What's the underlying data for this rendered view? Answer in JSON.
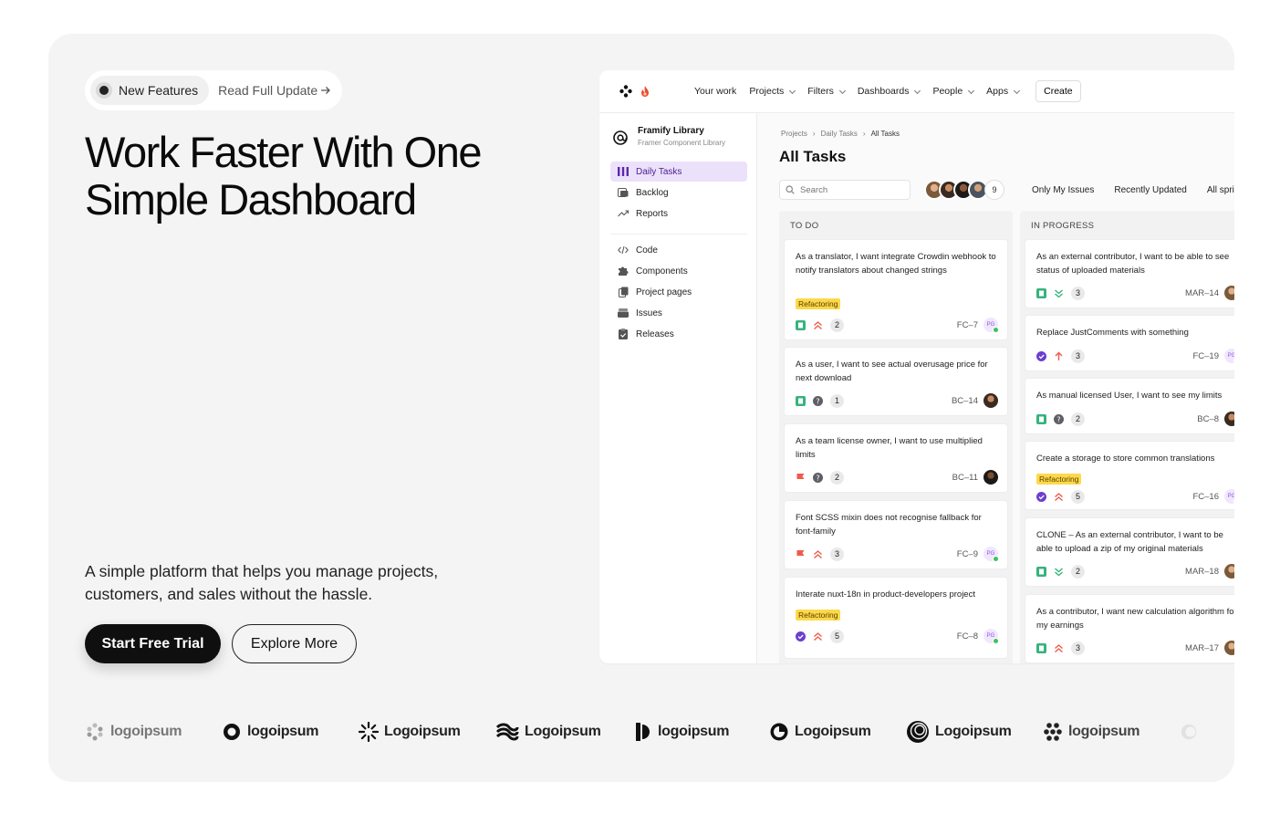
{
  "hero": {
    "badge_label": "New Features",
    "read_update_label": "Read Full Update",
    "title_line1": "Work Faster With One",
    "title_line2": "Simple Dashboard",
    "subtitle": "A simple platform that helps you manage projects, customers, and sales without the hassle.",
    "primary_cta": "Start Free Trial",
    "secondary_cta": "Explore More"
  },
  "logos": [
    "logoipsum",
    "logoipsum",
    "Logoipsum",
    "Logoipsum",
    "logoipsum",
    "Logoipsum",
    "Logoipsum",
    "logoipsum"
  ],
  "app": {
    "nav": {
      "your_work": "Your work",
      "projects": "Projects",
      "filters": "Filters",
      "dashboards": "Dashboards",
      "people": "People",
      "apps": "Apps",
      "create": "Create"
    },
    "sidebar": {
      "project_name": "Framify Library",
      "project_sub": "Framer Component Library",
      "items": [
        "Daily Tasks",
        "Backlog",
        "Reports",
        "Code",
        "Components",
        "Project pages",
        "Issues",
        "Releases"
      ]
    },
    "breadcrumb": [
      "Projects",
      "Daily Tasks",
      "All Tasks"
    ],
    "page_title": "All Tasks",
    "search_placeholder": "Search",
    "member_count": "9",
    "filters": [
      "Only My Issues",
      "Recently Updated",
      "All sprints"
    ],
    "columns": [
      {
        "title": "TO DO",
        "cards": [
          {
            "text": "As a translator, I want integrate Crowdin webhook to notify translators about changed strings",
            "tag": "Refactoring",
            "count": "2",
            "key": "FC–7",
            "assignee": "PG"
          },
          {
            "text": "As a user, I want to see actual overusage price for next download",
            "count": "1",
            "key": "BC–14"
          },
          {
            "text": "As a team license owner, I want to use multiplied limits",
            "count": "2",
            "key": "BC–11"
          },
          {
            "text": "Font SCSS mixin does not recognise fallback for font-family",
            "count": "3",
            "key": "FC–9",
            "assignee": "PG"
          },
          {
            "text": "Interate nuxt-18n in product-developers project",
            "tag": "Refactoring",
            "count": "5",
            "key": "FC–8",
            "assignee": "PG"
          }
        ]
      },
      {
        "title": "IN PROGRESS",
        "cards": [
          {
            "text": "As an external contributor, I want to be able to see status of uploaded materials",
            "count": "3",
            "key": "MAR–14"
          },
          {
            "text": "Replace JustComments with something",
            "count": "3",
            "key": "FC–19",
            "assignee": "PG"
          },
          {
            "text": "As manual licensed User, I want to see my limits",
            "count": "2",
            "key": "BC–8"
          },
          {
            "text": "Create a storage to store common translations",
            "tag": "Refactoring",
            "count": "5",
            "key": "FC–16",
            "assignee": "PG"
          },
          {
            "text": "CLONE – As an external contributor, I want to be able to upload a zip of my original materials",
            "count": "2",
            "key": "MAR–18"
          },
          {
            "text": "As a contributor, I want new calculation algorithm for my earnings",
            "count": "3",
            "key": "MAR–17"
          }
        ]
      }
    ]
  }
}
